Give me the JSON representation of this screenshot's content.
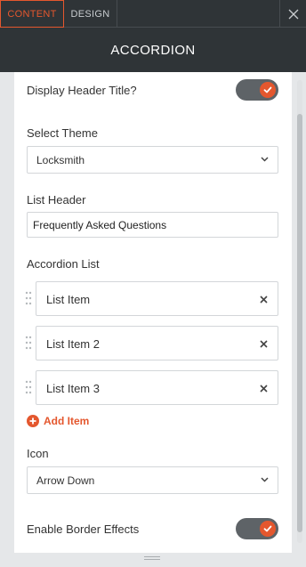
{
  "tabs": [
    {
      "label": "CONTENT",
      "active": true
    },
    {
      "label": "DESIGN",
      "active": false
    }
  ],
  "header": {
    "title": "ACCORDION"
  },
  "display_header_title": {
    "label": "Display Header Title?",
    "enabled": true
  },
  "theme": {
    "label": "Select Theme",
    "value": "Locksmith"
  },
  "list_header": {
    "label": "List Header",
    "value": "Frequently Asked Questions"
  },
  "accordion_list": {
    "label": "Accordion List",
    "items": [
      {
        "label": "List Item"
      },
      {
        "label": "List Item 2"
      },
      {
        "label": "List Item 3"
      }
    ],
    "add_label": "Add Item"
  },
  "icon": {
    "label": "Icon",
    "value": "Arrow Down"
  },
  "border_effects": {
    "label": "Enable Border Effects",
    "enabled": true
  },
  "colors": {
    "accent": "#e4572e",
    "dark": "#2f3437",
    "toggle_track": "#5e6367"
  },
  "icons": [
    "close-icon",
    "check-icon",
    "chevron-down-icon",
    "drag-handle-icon",
    "remove-icon",
    "plus-icon"
  ]
}
